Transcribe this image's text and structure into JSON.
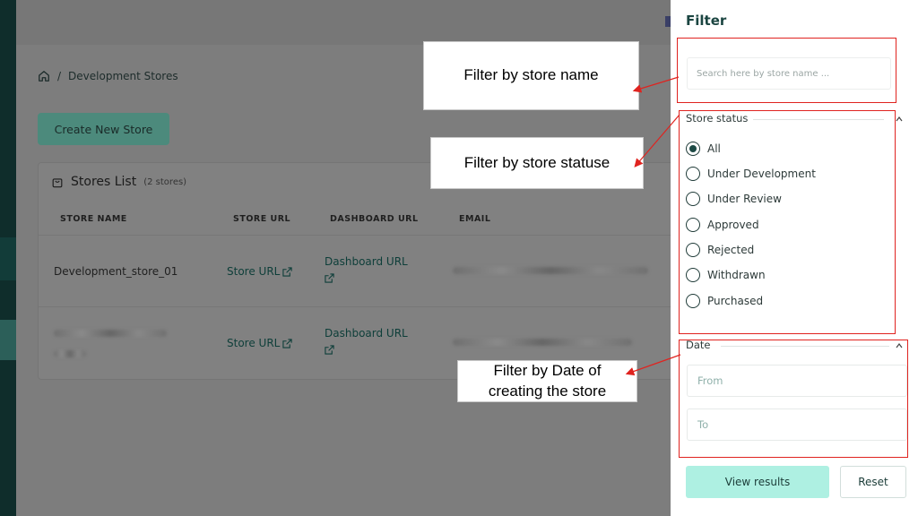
{
  "breadcrumb": {
    "home_icon": "home-icon",
    "separator": "/",
    "current": "Development Stores"
  },
  "actions": {
    "create_store": "Create New Store"
  },
  "stores_card": {
    "title": "Stores List",
    "count": "(2 stores)",
    "columns": [
      "STORE NAME",
      "STORE URL",
      "DASHBOARD URL",
      "EMAIL"
    ],
    "rows": [
      {
        "name": "Development_store_01",
        "store_url": "Store URL",
        "dashboard_url": "Dashboard URL"
      },
      {
        "name": "",
        "store_url": "Store URL",
        "dashboard_url": "Dashboard URL"
      }
    ]
  },
  "callouts": {
    "store_name": "Filter by store name",
    "store_status": "Filter by store statuse",
    "date_line1": "Filter by Date of",
    "date_line2": "creating the store"
  },
  "filter_panel": {
    "title": "Filter",
    "search_placeholder": "Search here by store name ...",
    "status_label": "Store status",
    "status_options": [
      "All",
      "Under Development",
      "Under Review",
      "Approved",
      "Rejected",
      "Withdrawn",
      "Purchased"
    ],
    "selected_status": "All",
    "date_label": "Date",
    "from_placeholder": "From",
    "to_placeholder": "To",
    "view_results": "View results",
    "reset": "Reset"
  },
  "colors": {
    "accent": "#aef0e2",
    "primary_dark": "#1b4541",
    "annotation_red": "#e0231f"
  }
}
